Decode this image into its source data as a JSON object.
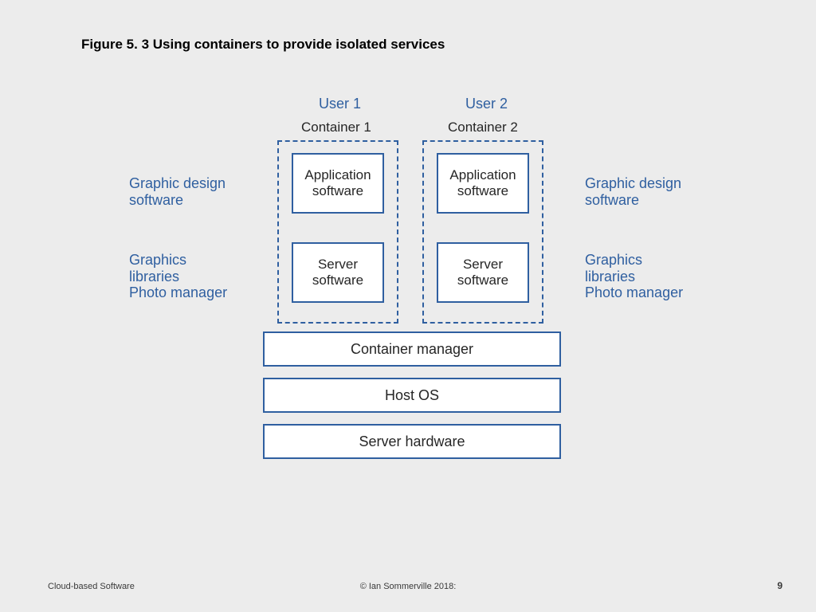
{
  "title": "Figure 5. 3 Using containers to provide isolated services",
  "footer": {
    "left": "Cloud-based Software",
    "center": "© Ian Sommerville 2018:",
    "right": "9"
  },
  "diagram": {
    "users": {
      "u1": "User 1",
      "u2": "User 2"
    },
    "containers": {
      "c1": "Container 1",
      "c2": "Container 2"
    },
    "sideLabels": {
      "left_top": "Graphic design\nsoftware",
      "left_bottom": "Graphics\nlibraries\nPhoto manager",
      "right_top": "Graphic design\nsoftware",
      "right_bottom": "Graphics\nlibraries\nPhoto manager"
    },
    "innerBoxes": {
      "app": "Application\nsoftware",
      "server": "Server\nsoftware"
    },
    "layers": {
      "container_manager": "Container manager",
      "host_os": "Host OS",
      "server_hw": "Server hardware"
    }
  }
}
